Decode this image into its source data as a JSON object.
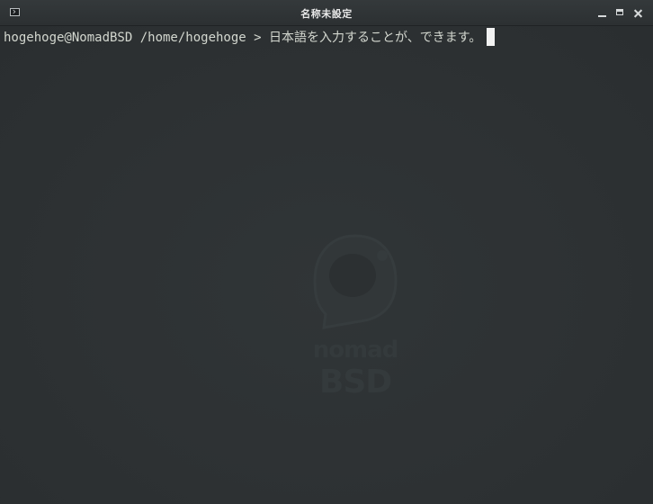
{
  "window": {
    "title": "名称未設定",
    "icon": "terminal-icon",
    "controls": [
      "minimize-icon",
      "maximize-icon",
      "close-icon"
    ]
  },
  "terminal": {
    "prompt": "hogehoge@NomadBSD /home/hogehoge > ",
    "input_text": "日本語を入力することが、できます。"
  },
  "wallpaper": {
    "watermark_line1": "nomad",
    "watermark_line2": "BSD"
  },
  "colors": {
    "background": "#2e3234",
    "titlebar": "#2c3032",
    "text": "#d3d7cf",
    "cursor": "#f2f2f2"
  }
}
